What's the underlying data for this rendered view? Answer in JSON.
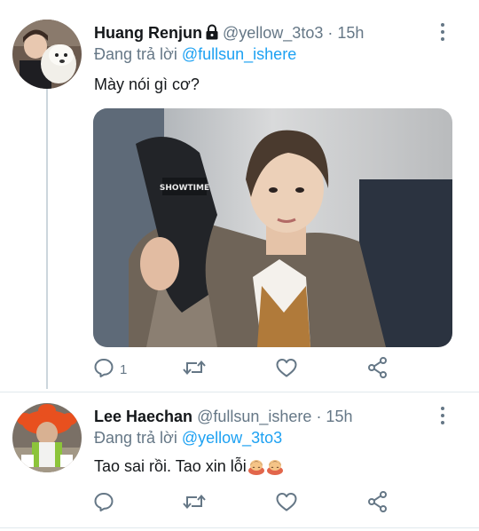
{
  "tweets": [
    {
      "name": "Huang Renjun",
      "handle": "@yellow_3to3",
      "time": "· 15h",
      "reply_prefix": "Đang trả lời",
      "reply_to": "@fullsun_ishere",
      "text": "Mày nói gì cơ?",
      "reply_count": "1",
      "locked": true,
      "has_media": true,
      "media_text": "SHOWTIME"
    },
    {
      "name": "Lee Haechan",
      "handle": "@fullsun_ishere",
      "time": "· 15h",
      "reply_prefix": "Đang trả lời",
      "reply_to": "@yellow_3to3",
      "text": "Tao sai rồi. Tao xin lỗi",
      "emojis": [
        "person-bowing-emoji",
        "person-bowing-emoji"
      ],
      "reply_count": "",
      "locked": false,
      "has_media": false
    }
  ],
  "icons": [
    "reply-icon",
    "retweet-icon",
    "like-icon",
    "share-icon",
    "more-options-icon",
    "lock-icon"
  ],
  "colors": {
    "accent": "#1da1f2",
    "secondary_text": "#657786",
    "primary_text": "#14171a",
    "thread_line": "#ccd6dd"
  }
}
